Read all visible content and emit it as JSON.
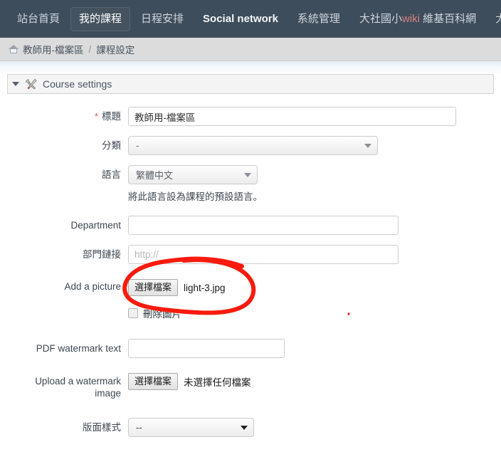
{
  "navbar": {
    "items": [
      {
        "label": "站台首頁",
        "active": false,
        "bright": false
      },
      {
        "label": "我的課程",
        "active": true,
        "bright": false
      },
      {
        "label": "日程安排",
        "active": false,
        "bright": false
      },
      {
        "label": "Social network",
        "active": false,
        "bright": true
      },
      {
        "label": "系統管理",
        "active": false,
        "bright": false
      },
      {
        "label": "大社國小wiki 維基百科網",
        "active": false,
        "bright": false
      },
      {
        "label": "大社國小首頁",
        "active": false,
        "bright": false
      }
    ],
    "background_color": "#3e4d5c",
    "active_background_color": "#44535f",
    "link_color": "#cfd6dd"
  },
  "breadcrumb": {
    "home_icon": "home-icon",
    "items": [
      "教師用-檔案區",
      "課程設定"
    ],
    "separator": "/"
  },
  "section": {
    "title": "Course settings",
    "icon": "tools-icon",
    "caret": "caret-down-icon"
  },
  "form": {
    "title": {
      "label": "標題",
      "required_marker": "*",
      "value": "教師用-檔案區",
      "placeholder": ""
    },
    "category": {
      "label": "分類",
      "value": "-"
    },
    "language": {
      "label": "語言",
      "value": "繁體中文",
      "help": "將此語言設為課程的預設語言。"
    },
    "department": {
      "label": "Department",
      "value": "",
      "placeholder": ""
    },
    "department_url": {
      "label": "部門鏈接",
      "value": "",
      "placeholder": "http://"
    },
    "add_picture": {
      "label": "Add a picture",
      "button_label": "選擇檔案",
      "file_name": "light-3.jpg",
      "delete_checkbox_label": "刪除圖片",
      "delete_checked": false
    },
    "pdf_watermark_text": {
      "label": "PDF watermark text",
      "value": "",
      "placeholder": ""
    },
    "watermark_image": {
      "label": "Upload a watermark image",
      "button_label": "選擇檔案",
      "file_name": "未選擇任何檔案"
    },
    "layout": {
      "label": "版面樣式",
      "value": "--"
    }
  },
  "annotation": {
    "type": "hand-drawn-ellipse",
    "color": "#f81b0e",
    "target": "add-a-picture-file-chooser"
  }
}
